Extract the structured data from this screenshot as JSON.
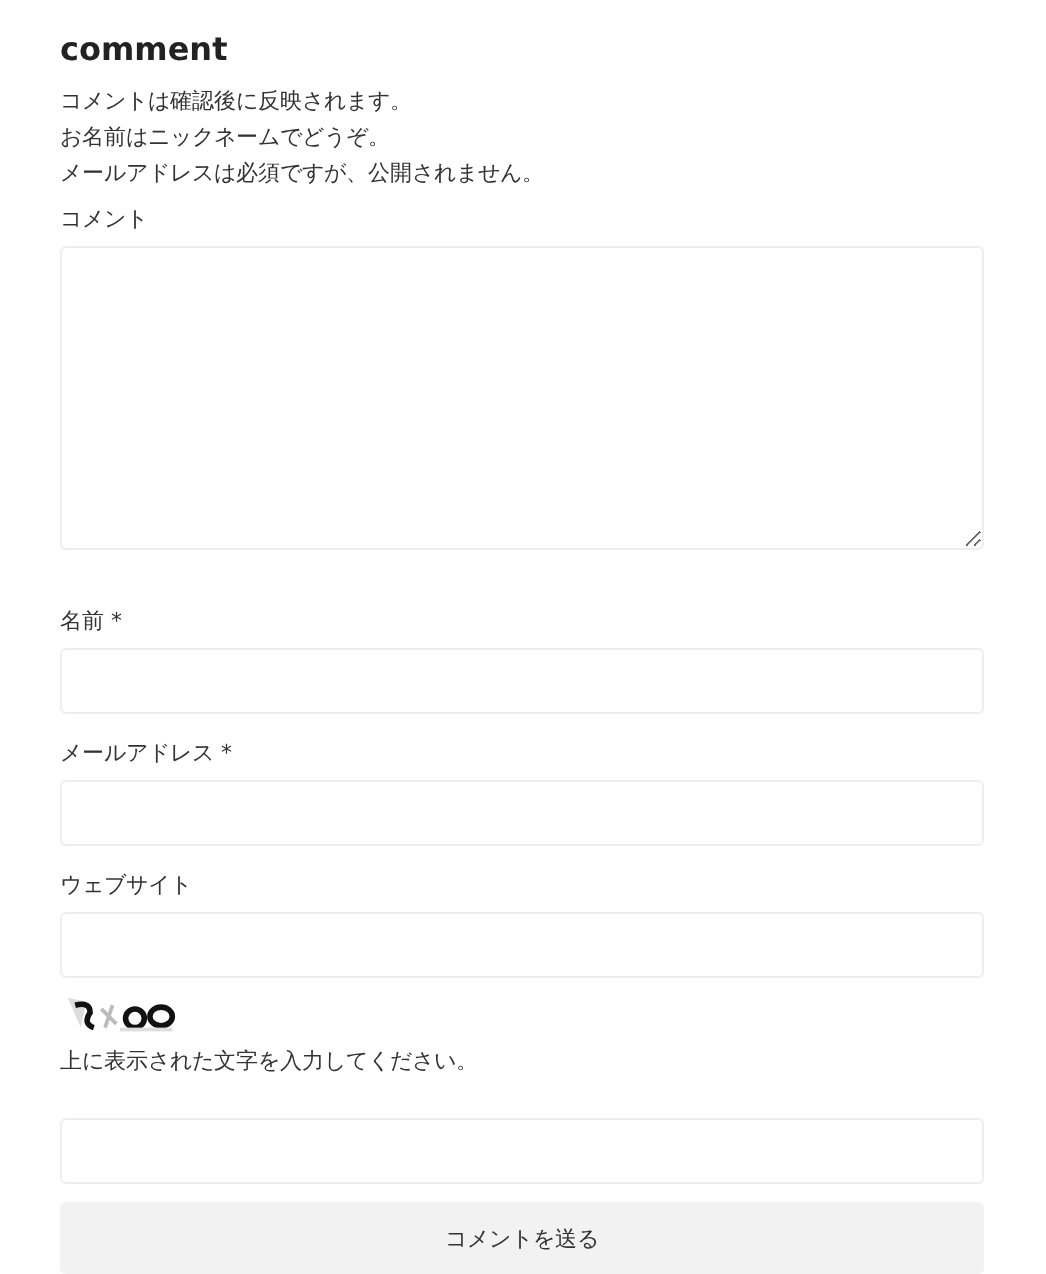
{
  "title": "comment",
  "notes": [
    "コメントは確認後に反映されます。",
    "お名前はニックネームでどうぞ。",
    "メールアドレスは必須ですが、公開されません。"
  ],
  "fields": [
    {
      "kind": "textarea",
      "label": "コメント"
    },
    {
      "kind": "input",
      "label": "名前 *"
    },
    {
      "kind": "input",
      "label": "メールアドレス *"
    },
    {
      "kind": "input",
      "label": "ウェブサイト"
    }
  ],
  "captcha": {
    "kind": "picture",
    "instruction": "上に表示された文字を入力してください。"
  },
  "submit": "コメントを送る"
}
